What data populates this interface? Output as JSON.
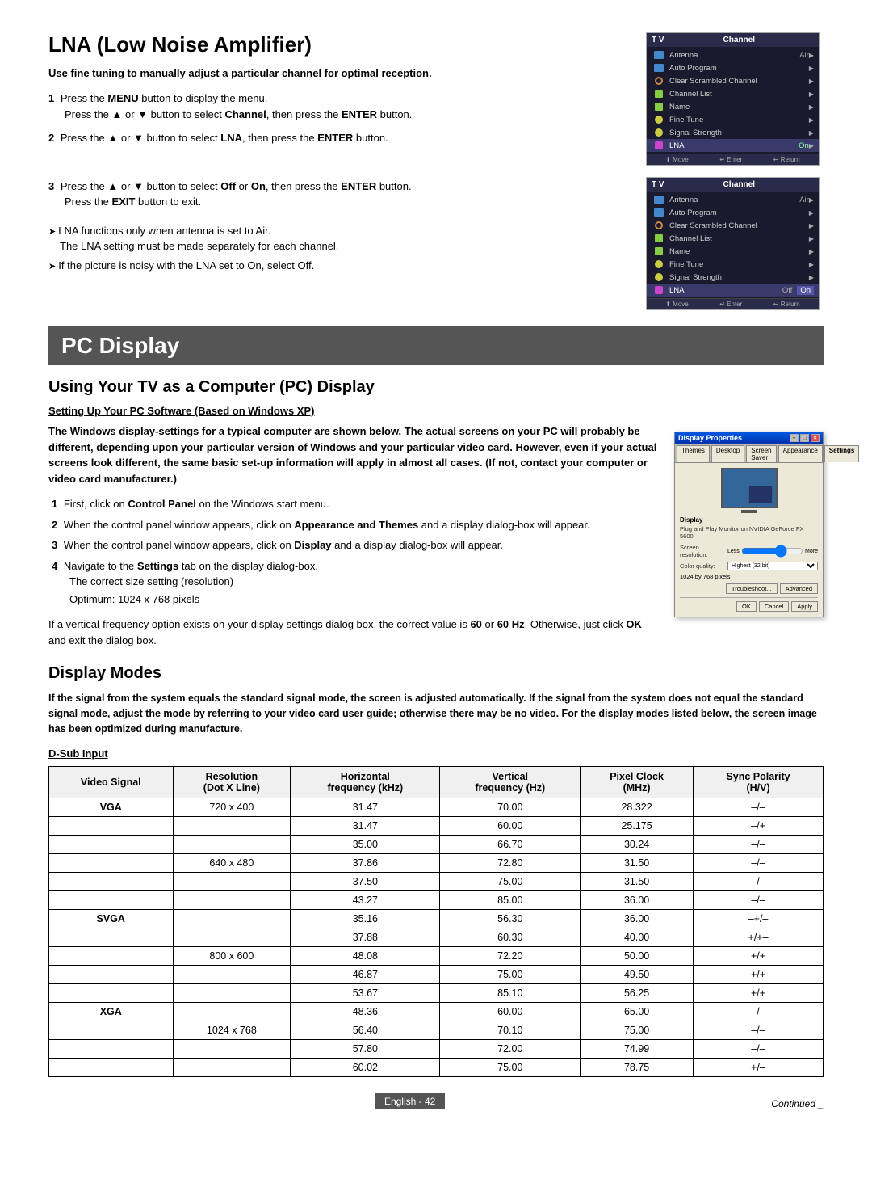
{
  "lna": {
    "title": "LNA (Low Noise Amplifier)",
    "subtitle": "Use fine tuning to manually adjust a particular channel for optimal reception.",
    "steps": [
      {
        "num": "1",
        "text": "Press the ",
        "bold1": "MENU",
        "text2": " button to display the menu.",
        "indent": "Press the ▲ or ▼ button to select ",
        "bold2": "Channel",
        "text3": ", then press the ",
        "bold3": "ENTER",
        "text4": " button."
      },
      {
        "num": "2",
        "text": "Press the ▲ or ▼ button to select ",
        "bold1": "LNA",
        "text2": ", then press the ",
        "bold2": "ENTER",
        "text3": " button."
      },
      {
        "num": "3",
        "text": "Press the ▲ or ▼ button to select ",
        "bold1": "Off",
        "text2": " or ",
        "bold2": "On",
        "text3": ", then press the ",
        "bold3": "ENTER",
        "text4": " button.",
        "indent": "Press the ",
        "exitBold": "EXIT",
        "indent2": " button to exit."
      }
    ],
    "notes": [
      "LNA functions only when antenna is set to Air.\nThe LNA setting must be made separately for each channel.",
      "If the picture is noisy with the LNA set to On, select Off."
    ],
    "tv_screen1": {
      "title": "T V",
      "channel_label": "Channel",
      "items": [
        {
          "icon": "pic",
          "label": "Antenna",
          "value": "Air",
          "arrow": true
        },
        {
          "icon": "pic",
          "label": "Auto Program",
          "value": "",
          "arrow": true
        },
        {
          "icon": "sound",
          "label": "Clear Scrambled Channel",
          "value": "",
          "arrow": true
        },
        {
          "icon": "ch",
          "label": "Channel List",
          "value": "",
          "arrow": true
        },
        {
          "icon": "ch",
          "label": "Name",
          "value": "",
          "arrow": true
        },
        {
          "icon": "setup",
          "label": "Fine Tune",
          "value": "",
          "arrow": true
        },
        {
          "icon": "setup",
          "label": "Signal Strength",
          "value": "",
          "arrow": true
        },
        {
          "icon": "input",
          "label": "LNA",
          "value": "On",
          "highlighted": true
        }
      ],
      "nav": "⬆ Move   ↵ Enter   ↩ Return"
    },
    "tv_screen2": {
      "title": "T V",
      "channel_label": "Channel",
      "items": [
        {
          "icon": "pic",
          "label": "Antenna",
          "value": "Air",
          "arrow": true
        },
        {
          "icon": "pic",
          "label": "Auto Program",
          "value": "",
          "arrow": true
        },
        {
          "icon": "sound",
          "label": "Clear Scrambled Channel",
          "value": "",
          "arrow": true
        },
        {
          "icon": "ch",
          "label": "Channel List",
          "value": "",
          "arrow": true
        },
        {
          "icon": "ch",
          "label": "Name",
          "value": "",
          "arrow": true
        },
        {
          "icon": "setup",
          "label": "Fine Tune",
          "value": "",
          "arrow": true
        },
        {
          "icon": "setup",
          "label": "Signal Strength",
          "value": "",
          "arrow": true
        },
        {
          "icon": "input",
          "label": "LNA",
          "off": "Off",
          "on": "On",
          "highlighted": true
        }
      ],
      "nav": "⬆ Move   ↵ Enter   ↩ Return"
    }
  },
  "pc_display": {
    "section_title": "PC Display",
    "using_title": "Using Your TV as a Computer (PC) Display",
    "subsection": "Setting Up Your PC Software (Based on Windows XP)",
    "intro": "The Windows display-settings for a typical computer are shown below. The actual screens on your PC will probably be different, depending upon your particular version of Windows and your particular video card. However, even if your actual screens look different, the same basic set-up information will apply in almost all cases. (If not, contact your computer or video card manufacturer.)",
    "steps": [
      {
        "num": "1",
        "text": "First, click on ",
        "bold": "Control Panel",
        "rest": " on the Windows start menu."
      },
      {
        "num": "2",
        "text": "When the control panel window appears, click on ",
        "bold": "Appearance and Themes",
        "rest": " and a display dialog-box will appear."
      },
      {
        "num": "3",
        "text": "When the control panel window appears, click on ",
        "bold": "Display",
        "rest": " and a display dialog-box will appear."
      },
      {
        "num": "4",
        "text": "Navigate to the ",
        "bold": "Settings",
        "rest": " tab on the display dialog-box."
      }
    ],
    "resolution_note": "The correct size setting (resolution)",
    "optimum": "Optimum: 1024 x 768 pixels",
    "freq_note": "If a vertical-frequency option exists on your display settings dialog box, the correct value is ",
    "freq_bold": "60",
    "freq_rest": " or 60 Hz. Otherwise, just click ",
    "ok_bold": "OK",
    "freq_end": " and exit the dialog box.",
    "dialog": {
      "title": "Display Properties",
      "tabs": [
        "Themes",
        "Desktop",
        "Screen Saver",
        "Appearance",
        "Settings"
      ],
      "active_tab": "Settings",
      "display_label": "Display",
      "display_desc": "Plug and Play Monitor on NVIDIA GeForce FX 5600",
      "resolution_label": "Screen resolution:",
      "resolution_value": "Less",
      "color_label": "Color quality:",
      "color_value": "Highest (32 bit)",
      "pixels_value": "1024 by 768 pixels",
      "buttons": [
        "Troubleshoot...",
        "Advanced"
      ],
      "bottom_buttons": [
        "OK",
        "Cancel",
        "Apply"
      ]
    }
  },
  "display_modes": {
    "section_title": "Display Modes",
    "intro": "If the signal from the system equals the standard signal mode, the screen is adjusted automatically. If the signal from the system does not equal the standard signal mode, adjust the mode by referring to your video card user guide; otherwise there may be no video. For the display modes listed below, the screen image has been optimized during manufacture.",
    "table_label": "D-Sub Input",
    "columns": {
      "video_signal": "Video Signal",
      "resolution": "Resolution\n(Dot X Line)",
      "horizontal": "Horizontal\nfrequency (kHz)",
      "vertical": "Vertical\nfrequency (Hz)",
      "pixel_clock": "Pixel Clock\n(MHz)",
      "sync_polarity": "Sync Polarity\n(H/V)"
    },
    "rows": [
      {
        "signal": "VGA",
        "resolution": "720 x 400",
        "h_freq": "31.47",
        "v_freq": "70.00",
        "pixel": "28.322",
        "sync": "–/–"
      },
      {
        "signal": "",
        "resolution": "",
        "h_freq": "31.47",
        "v_freq": "60.00",
        "pixel": "25.175",
        "sync": "–/+"
      },
      {
        "signal": "",
        "resolution": "",
        "h_freq": "35.00",
        "v_freq": "66.70",
        "pixel": "30.24",
        "sync": "–/–"
      },
      {
        "signal": "",
        "resolution": "640 x 480",
        "h_freq": "37.86",
        "v_freq": "72.80",
        "pixel": "31.50",
        "sync": "–/–"
      },
      {
        "signal": "",
        "resolution": "",
        "h_freq": "37.50",
        "v_freq": "75.00",
        "pixel": "31.50",
        "sync": "–/–"
      },
      {
        "signal": "",
        "resolution": "",
        "h_freq": "43.27",
        "v_freq": "85.00",
        "pixel": "36.00",
        "sync": "–/–"
      },
      {
        "signal": "SVGA",
        "resolution": "",
        "h_freq": "35.16",
        "v_freq": "56.30",
        "pixel": "36.00",
        "sync": "–+/–"
      },
      {
        "signal": "",
        "resolution": "",
        "h_freq": "37.88",
        "v_freq": "60.30",
        "pixel": "40.00",
        "sync": "+/+–"
      },
      {
        "signal": "",
        "resolution": "800 x 600",
        "h_freq": "48.08",
        "v_freq": "72.20",
        "pixel": "50.00",
        "sync": "+/+"
      },
      {
        "signal": "",
        "resolution": "",
        "h_freq": "46.87",
        "v_freq": "75.00",
        "pixel": "49.50",
        "sync": "+/+"
      },
      {
        "signal": "",
        "resolution": "",
        "h_freq": "53.67",
        "v_freq": "85.10",
        "pixel": "56.25",
        "sync": "+/+"
      },
      {
        "signal": "XGA",
        "resolution": "",
        "h_freq": "48.36",
        "v_freq": "60.00",
        "pixel": "65.00",
        "sync": "–/–"
      },
      {
        "signal": "",
        "resolution": "1024 x 768",
        "h_freq": "56.40",
        "v_freq": "70.10",
        "pixel": "75.00",
        "sync": "–/–"
      },
      {
        "signal": "",
        "resolution": "",
        "h_freq": "57.80",
        "v_freq": "72.00",
        "pixel": "74.99",
        "sync": "–/–"
      },
      {
        "signal": "",
        "resolution": "",
        "h_freq": "60.02",
        "v_freq": "75.00",
        "pixel": "78.75",
        "sync": "+/–"
      }
    ]
  },
  "footer": {
    "page_num": "English - 42",
    "continued": "Continued _"
  }
}
